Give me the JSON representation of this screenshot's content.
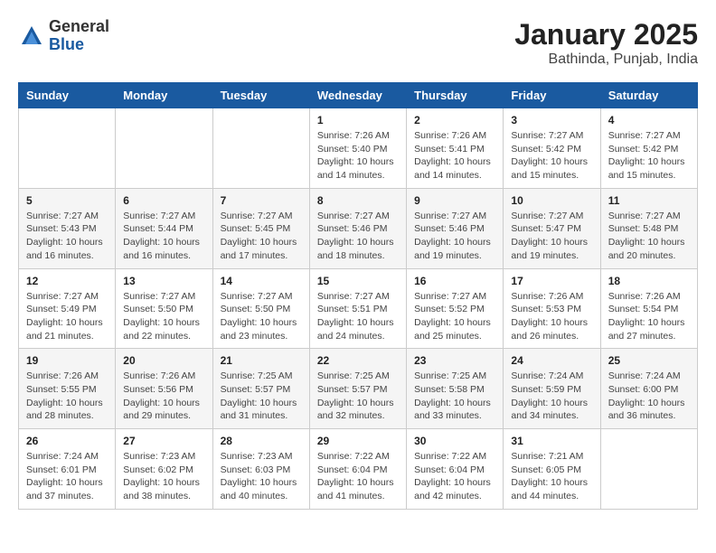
{
  "header": {
    "logo_general": "General",
    "logo_blue": "Blue",
    "month_year": "January 2025",
    "location": "Bathinda, Punjab, India"
  },
  "weekdays": [
    "Sunday",
    "Monday",
    "Tuesday",
    "Wednesday",
    "Thursday",
    "Friday",
    "Saturday"
  ],
  "weeks": [
    [
      {
        "day": "",
        "info": ""
      },
      {
        "day": "",
        "info": ""
      },
      {
        "day": "",
        "info": ""
      },
      {
        "day": "1",
        "info": "Sunrise: 7:26 AM\nSunset: 5:40 PM\nDaylight: 10 hours\nand 14 minutes."
      },
      {
        "day": "2",
        "info": "Sunrise: 7:26 AM\nSunset: 5:41 PM\nDaylight: 10 hours\nand 14 minutes."
      },
      {
        "day": "3",
        "info": "Sunrise: 7:27 AM\nSunset: 5:42 PM\nDaylight: 10 hours\nand 15 minutes."
      },
      {
        "day": "4",
        "info": "Sunrise: 7:27 AM\nSunset: 5:42 PM\nDaylight: 10 hours\nand 15 minutes."
      }
    ],
    [
      {
        "day": "5",
        "info": "Sunrise: 7:27 AM\nSunset: 5:43 PM\nDaylight: 10 hours\nand 16 minutes."
      },
      {
        "day": "6",
        "info": "Sunrise: 7:27 AM\nSunset: 5:44 PM\nDaylight: 10 hours\nand 16 minutes."
      },
      {
        "day": "7",
        "info": "Sunrise: 7:27 AM\nSunset: 5:45 PM\nDaylight: 10 hours\nand 17 minutes."
      },
      {
        "day": "8",
        "info": "Sunrise: 7:27 AM\nSunset: 5:46 PM\nDaylight: 10 hours\nand 18 minutes."
      },
      {
        "day": "9",
        "info": "Sunrise: 7:27 AM\nSunset: 5:46 PM\nDaylight: 10 hours\nand 19 minutes."
      },
      {
        "day": "10",
        "info": "Sunrise: 7:27 AM\nSunset: 5:47 PM\nDaylight: 10 hours\nand 19 minutes."
      },
      {
        "day": "11",
        "info": "Sunrise: 7:27 AM\nSunset: 5:48 PM\nDaylight: 10 hours\nand 20 minutes."
      }
    ],
    [
      {
        "day": "12",
        "info": "Sunrise: 7:27 AM\nSunset: 5:49 PM\nDaylight: 10 hours\nand 21 minutes."
      },
      {
        "day": "13",
        "info": "Sunrise: 7:27 AM\nSunset: 5:50 PM\nDaylight: 10 hours\nand 22 minutes."
      },
      {
        "day": "14",
        "info": "Sunrise: 7:27 AM\nSunset: 5:50 PM\nDaylight: 10 hours\nand 23 minutes."
      },
      {
        "day": "15",
        "info": "Sunrise: 7:27 AM\nSunset: 5:51 PM\nDaylight: 10 hours\nand 24 minutes."
      },
      {
        "day": "16",
        "info": "Sunrise: 7:27 AM\nSunset: 5:52 PM\nDaylight: 10 hours\nand 25 minutes."
      },
      {
        "day": "17",
        "info": "Sunrise: 7:26 AM\nSunset: 5:53 PM\nDaylight: 10 hours\nand 26 minutes."
      },
      {
        "day": "18",
        "info": "Sunrise: 7:26 AM\nSunset: 5:54 PM\nDaylight: 10 hours\nand 27 minutes."
      }
    ],
    [
      {
        "day": "19",
        "info": "Sunrise: 7:26 AM\nSunset: 5:55 PM\nDaylight: 10 hours\nand 28 minutes."
      },
      {
        "day": "20",
        "info": "Sunrise: 7:26 AM\nSunset: 5:56 PM\nDaylight: 10 hours\nand 29 minutes."
      },
      {
        "day": "21",
        "info": "Sunrise: 7:25 AM\nSunset: 5:57 PM\nDaylight: 10 hours\nand 31 minutes."
      },
      {
        "day": "22",
        "info": "Sunrise: 7:25 AM\nSunset: 5:57 PM\nDaylight: 10 hours\nand 32 minutes."
      },
      {
        "day": "23",
        "info": "Sunrise: 7:25 AM\nSunset: 5:58 PM\nDaylight: 10 hours\nand 33 minutes."
      },
      {
        "day": "24",
        "info": "Sunrise: 7:24 AM\nSunset: 5:59 PM\nDaylight: 10 hours\nand 34 minutes."
      },
      {
        "day": "25",
        "info": "Sunrise: 7:24 AM\nSunset: 6:00 PM\nDaylight: 10 hours\nand 36 minutes."
      }
    ],
    [
      {
        "day": "26",
        "info": "Sunrise: 7:24 AM\nSunset: 6:01 PM\nDaylight: 10 hours\nand 37 minutes."
      },
      {
        "day": "27",
        "info": "Sunrise: 7:23 AM\nSunset: 6:02 PM\nDaylight: 10 hours\nand 38 minutes."
      },
      {
        "day": "28",
        "info": "Sunrise: 7:23 AM\nSunset: 6:03 PM\nDaylight: 10 hours\nand 40 minutes."
      },
      {
        "day": "29",
        "info": "Sunrise: 7:22 AM\nSunset: 6:04 PM\nDaylight: 10 hours\nand 41 minutes."
      },
      {
        "day": "30",
        "info": "Sunrise: 7:22 AM\nSunset: 6:04 PM\nDaylight: 10 hours\nand 42 minutes."
      },
      {
        "day": "31",
        "info": "Sunrise: 7:21 AM\nSunset: 6:05 PM\nDaylight: 10 hours\nand 44 minutes."
      },
      {
        "day": "",
        "info": ""
      }
    ]
  ]
}
